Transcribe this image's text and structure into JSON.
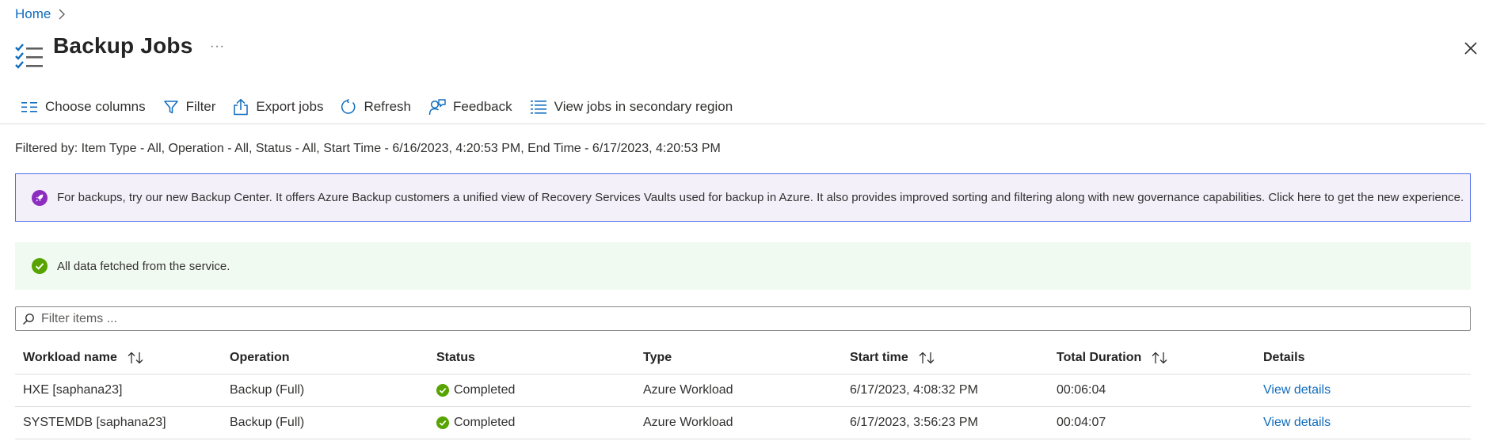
{
  "breadcrumb": {
    "home": "Home"
  },
  "header": {
    "title": "Backup Jobs",
    "more": "···"
  },
  "toolbar": {
    "choose_columns": "Choose columns",
    "filter": "Filter",
    "export_jobs": "Export jobs",
    "refresh": "Refresh",
    "feedback": "Feedback",
    "view_secondary": "View jobs in secondary region"
  },
  "filtered_by": "Filtered by: Item Type - All, Operation - All, Status - All, Start Time - 6/16/2023, 4:20:53 PM, End Time - 6/17/2023, 4:20:53 PM",
  "promo_banner": {
    "text": "For backups, try our new Backup Center. It offers Azure Backup customers a unified view of Recovery Services Vaults used for backup in Azure. It also provides improved sorting and filtering along with new governance capabilities. Click here to get the new experience."
  },
  "status_banner": {
    "text": "All data fetched from the service."
  },
  "filter_input": {
    "placeholder": "Filter items ..."
  },
  "table": {
    "columns": [
      "Workload name",
      "Operation",
      "Status",
      "Type",
      "Start time",
      "Total Duration",
      "Details"
    ],
    "rows": [
      {
        "workload": "HXE [saphana23]",
        "operation": "Backup (Full)",
        "status": "Completed",
        "type": "Azure Workload",
        "start": "6/17/2023, 4:08:32 PM",
        "duration": "00:06:04",
        "details": "View details"
      },
      {
        "workload": "SYSTEMDB [saphana23]",
        "operation": "Backup (Full)",
        "status": "Completed",
        "type": "Azure Workload",
        "start": "6/17/2023, 3:56:23 PM",
        "duration": "00:04:07",
        "details": "View details"
      }
    ]
  },
  "colors": {
    "accent": "#0f6cbd",
    "success": "#57a300",
    "promo_border": "#4f6bed",
    "promo_bg": "#f4f0fa",
    "success_bg": "#f1faf1",
    "rocket": "#8c2dbf"
  }
}
